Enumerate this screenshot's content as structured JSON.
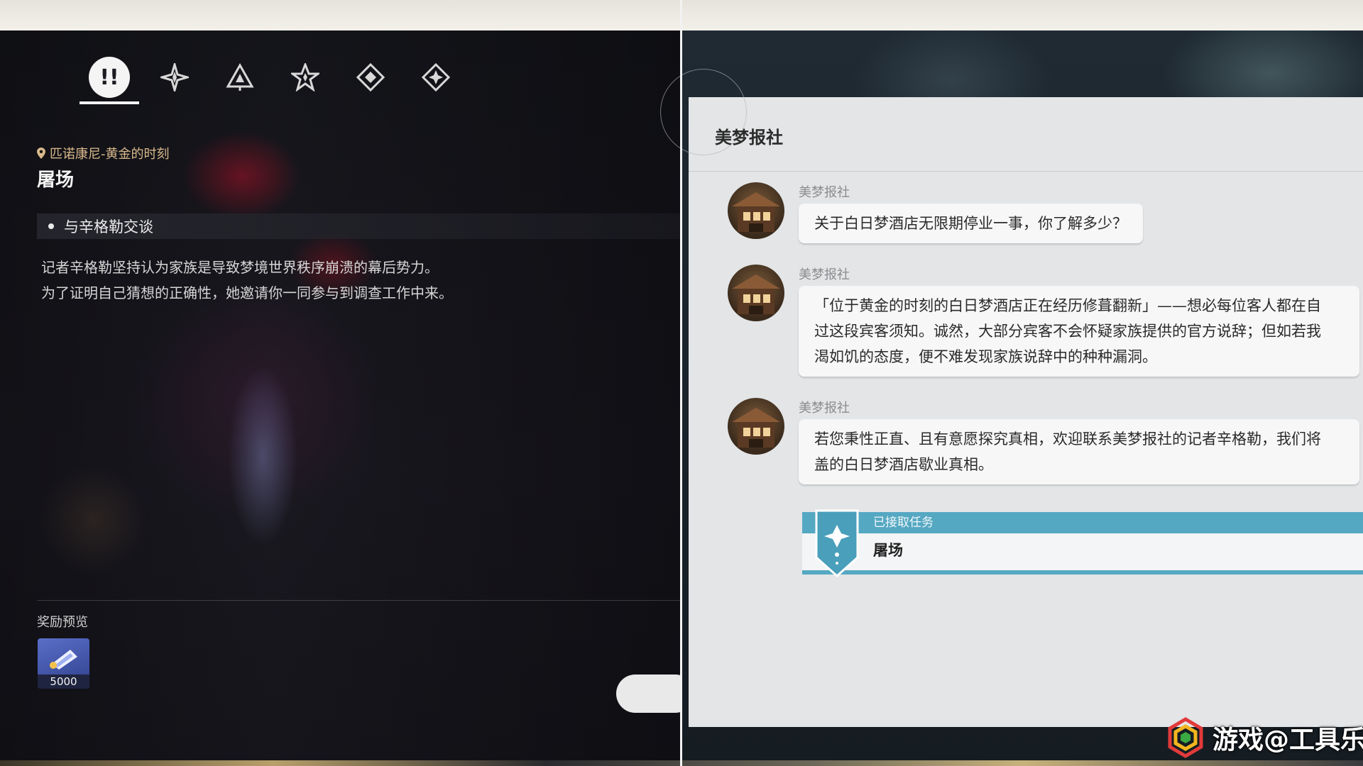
{
  "left_panel": {
    "tabs": [
      {
        "name": "tab-exclaim",
        "glyph": "!!",
        "active": true
      },
      {
        "name": "tab-compass-star",
        "active": false
      },
      {
        "name": "tab-triangle",
        "active": false
      },
      {
        "name": "tab-star",
        "active": false
      },
      {
        "name": "tab-diamond",
        "active": false
      },
      {
        "name": "tab-diamond-star",
        "active": false
      }
    ],
    "location": "匹诺康尼-黄金的时刻",
    "quest_title": "屠场",
    "objective": "与辛格勒交谈",
    "description": [
      "记者辛格勒坚持认为家族是导致梦境世界秩序崩溃的幕后势力。",
      "为了证明自己猜想的正确性，她邀请你一同参与到调查工作中来。"
    ],
    "reward_label": "奖励预览",
    "reward_amount": "5000"
  },
  "chat": {
    "title": "美梦报社",
    "messages": [
      {
        "sender": "美梦报社",
        "lines": [
          "关于白日梦酒店无限期停业一事，你了解多少？"
        ]
      },
      {
        "sender": "美梦报社",
        "lines": [
          "「位于黄金的时刻的白日梦酒店正在经历修葺翻新」——想必每位客人都在自",
          "过这段宾客须知。诚然，大部分宾客不会怀疑家族提供的官方说辞；但如若我",
          "渴如饥的态度，便不难发现家族说辞中的种种漏洞。"
        ]
      },
      {
        "sender": "美梦报社",
        "lines": [
          "若您秉性正直、且有意愿探究真相，欢迎联系美梦报社的记者辛格勒，我们将",
          "盖的白日梦酒店歇业真相。"
        ]
      }
    ],
    "task_card": {
      "status": "已接取任务",
      "name": "屠场"
    }
  },
  "watermark": "游戏@工具乐游网",
  "colors": {
    "accent_blue": "#55a8c2",
    "location_gold": "#d9b98c",
    "chat_bg": "#e3e5e7"
  }
}
